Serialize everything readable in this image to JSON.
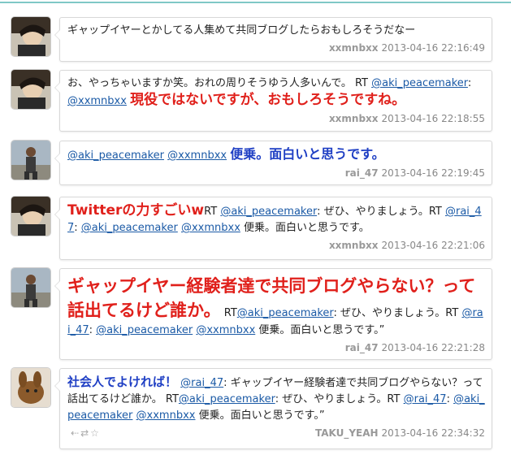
{
  "tweets": [
    {
      "segments": [
        {
          "text": "ギャップイヤーとかしてる人集めて共同ブログしたらおもしろそうだなー",
          "style": ""
        }
      ],
      "user": "xxmnbxx",
      "time": "2013-04-16 22:16:49"
    },
    {
      "segments": [
        {
          "text": "お、やっちゃいますか笑。おれの周りそうゆう人多いんで。 RT ",
          "style": ""
        },
        {
          "text": "@aki_peacemaker",
          "style": "mention"
        },
        {
          "text": ": ",
          "style": ""
        },
        {
          "text": "@xxmnbxx",
          "style": "mention"
        },
        {
          "text": " ",
          "style": ""
        },
        {
          "text": "現役ではないですが、おもしろそうですね。",
          "style": "red-l"
        }
      ],
      "user": "xxmnbxx",
      "time": "2013-04-16 22:18:55"
    },
    {
      "segments": [
        {
          "text": "@aki_peacemaker",
          "style": "mention"
        },
        {
          "text": " ",
          "style": ""
        },
        {
          "text": "@xxmnbxx",
          "style": "mention"
        },
        {
          "text": " ",
          "style": ""
        },
        {
          "text": "便乗。面白いと思うです。",
          "style": "blue-l"
        }
      ],
      "user": "rai_47",
      "time": "2013-04-16 22:19:45"
    },
    {
      "segments": [
        {
          "text": "Twitterの力すごいw",
          "style": "red-l"
        },
        {
          "text": "RT ",
          "style": ""
        },
        {
          "text": "@aki_peacemaker",
          "style": "mention"
        },
        {
          "text": ": ぜひ、やりましょう。RT ",
          "style": ""
        },
        {
          "text": "@rai_47",
          "style": "mention"
        },
        {
          "text": ": ",
          "style": ""
        },
        {
          "text": "@aki_peacemaker",
          "style": "mention"
        },
        {
          "text": " ",
          "style": ""
        },
        {
          "text": "@xxmnbxx",
          "style": "mention"
        },
        {
          "text": " 便乗。面白いと思うです。",
          "style": ""
        }
      ],
      "user": "xxmnbxx",
      "time": "2013-04-16 22:21:06"
    },
    {
      "segments": [
        {
          "text": "ギャップイヤー経験者達で共同ブログやらない？って話出てるけど誰か。",
          "style": "red-xl"
        },
        {
          "text": "  RT",
          "style": ""
        },
        {
          "text": "@aki_peacemaker",
          "style": "mention"
        },
        {
          "text": ": ぜひ、やりましょう。RT ",
          "style": ""
        },
        {
          "text": "@rai_47",
          "style": "mention"
        },
        {
          "text": ": ",
          "style": ""
        },
        {
          "text": "@aki_peacemaker",
          "style": "mention"
        },
        {
          "text": " ",
          "style": ""
        },
        {
          "text": "@xxmnbxx",
          "style": "mention"
        },
        {
          "text": " 便乗。面白いと思うです。”",
          "style": ""
        }
      ],
      "user": "rai_47",
      "time": "2013-04-16 22:21:28"
    },
    {
      "segments": [
        {
          "text": "社会人でよければ！",
          "style": "blue-m"
        },
        {
          "text": " ",
          "style": ""
        },
        {
          "text": "@rai_47",
          "style": "mention"
        },
        {
          "text": ": ギャップイヤー経験者達で共同ブログやらない？って話出てるけど誰か。 RT",
          "style": ""
        },
        {
          "text": "@aki_peacemaker",
          "style": "mention"
        },
        {
          "text": ": ぜひ、やりましょう。RT ",
          "style": ""
        },
        {
          "text": "@rai_47",
          "style": "mention"
        },
        {
          "text": ": ",
          "style": ""
        },
        {
          "text": "@aki_peacemaker",
          "style": "mention"
        },
        {
          "text": " ",
          "style": ""
        },
        {
          "text": "@xxmnbxx",
          "style": "mention"
        },
        {
          "text": " 便乗。面白いと思うです。”",
          "style": ""
        }
      ],
      "user": "TAKU_YEAH",
      "time": "2013-04-16 22:34:32",
      "actions": [
        "reply-icon",
        "retweet-icon",
        "favorite-icon"
      ],
      "action_glyphs": [
        "⇠",
        "⇄",
        "☆"
      ]
    }
  ],
  "colors": {
    "mention": "#1b5aa6",
    "red_emphasis": "#e0201b",
    "blue_emphasis": "#1f3fc4",
    "top_line": "#7fc8c6"
  }
}
